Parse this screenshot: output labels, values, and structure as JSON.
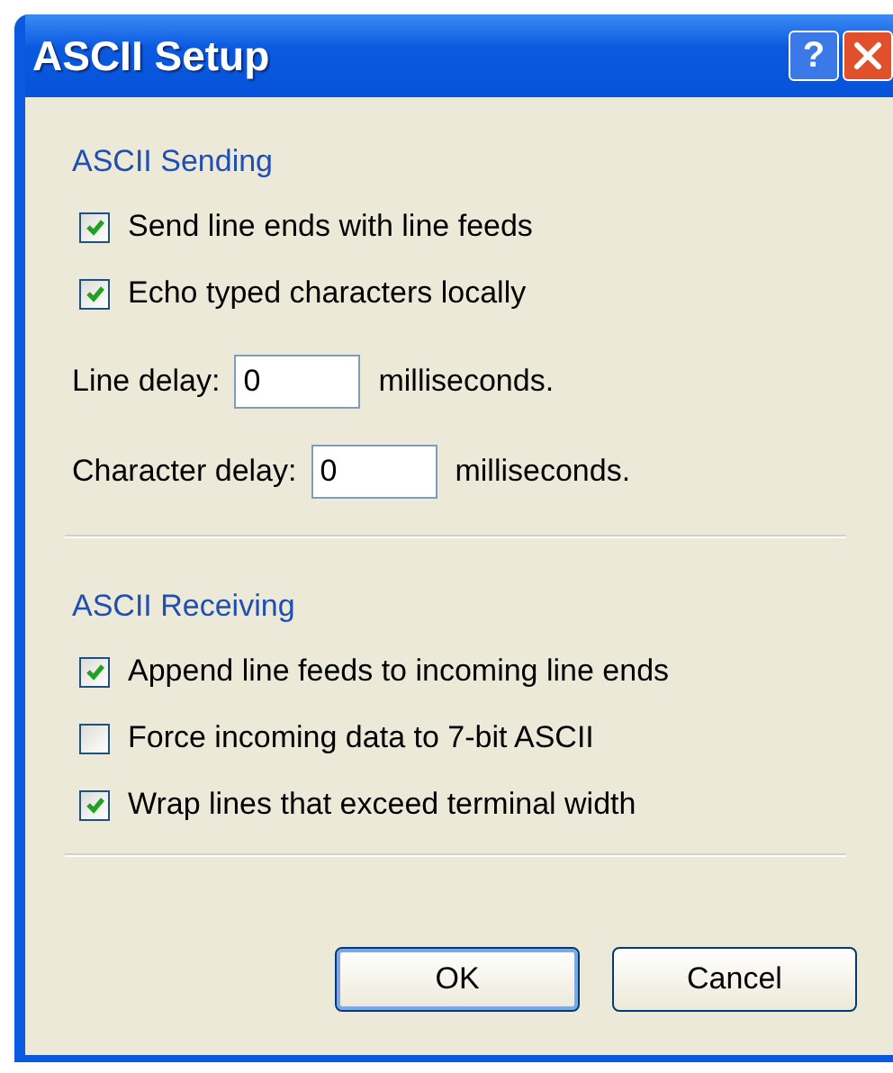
{
  "window": {
    "title": "ASCII Setup",
    "help_button": "?"
  },
  "sections": [
    {
      "title": "ASCII Sending",
      "items": [
        {
          "kind": "checkbox",
          "label": "Send line ends with line feeds",
          "checked": true
        },
        {
          "kind": "checkbox",
          "label": "Echo typed characters locally",
          "checked": true
        },
        {
          "kind": "field",
          "label": "Line delay:",
          "value": "0",
          "unit": "milliseconds."
        },
        {
          "kind": "field",
          "label": "Character delay:",
          "value": "0",
          "unit": "milliseconds."
        }
      ]
    },
    {
      "title": "ASCII Receiving",
      "items": [
        {
          "kind": "checkbox",
          "label": "Append line feeds to incoming line ends",
          "checked": true
        },
        {
          "kind": "checkbox",
          "label": "Force incoming data to 7-bit ASCII",
          "checked": false
        },
        {
          "kind": "checkbox",
          "label": "Wrap lines that exceed terminal width",
          "checked": true
        }
      ]
    }
  ],
  "buttons": [
    {
      "label": "OK",
      "default": true
    },
    {
      "label": "Cancel",
      "default": false
    }
  ]
}
